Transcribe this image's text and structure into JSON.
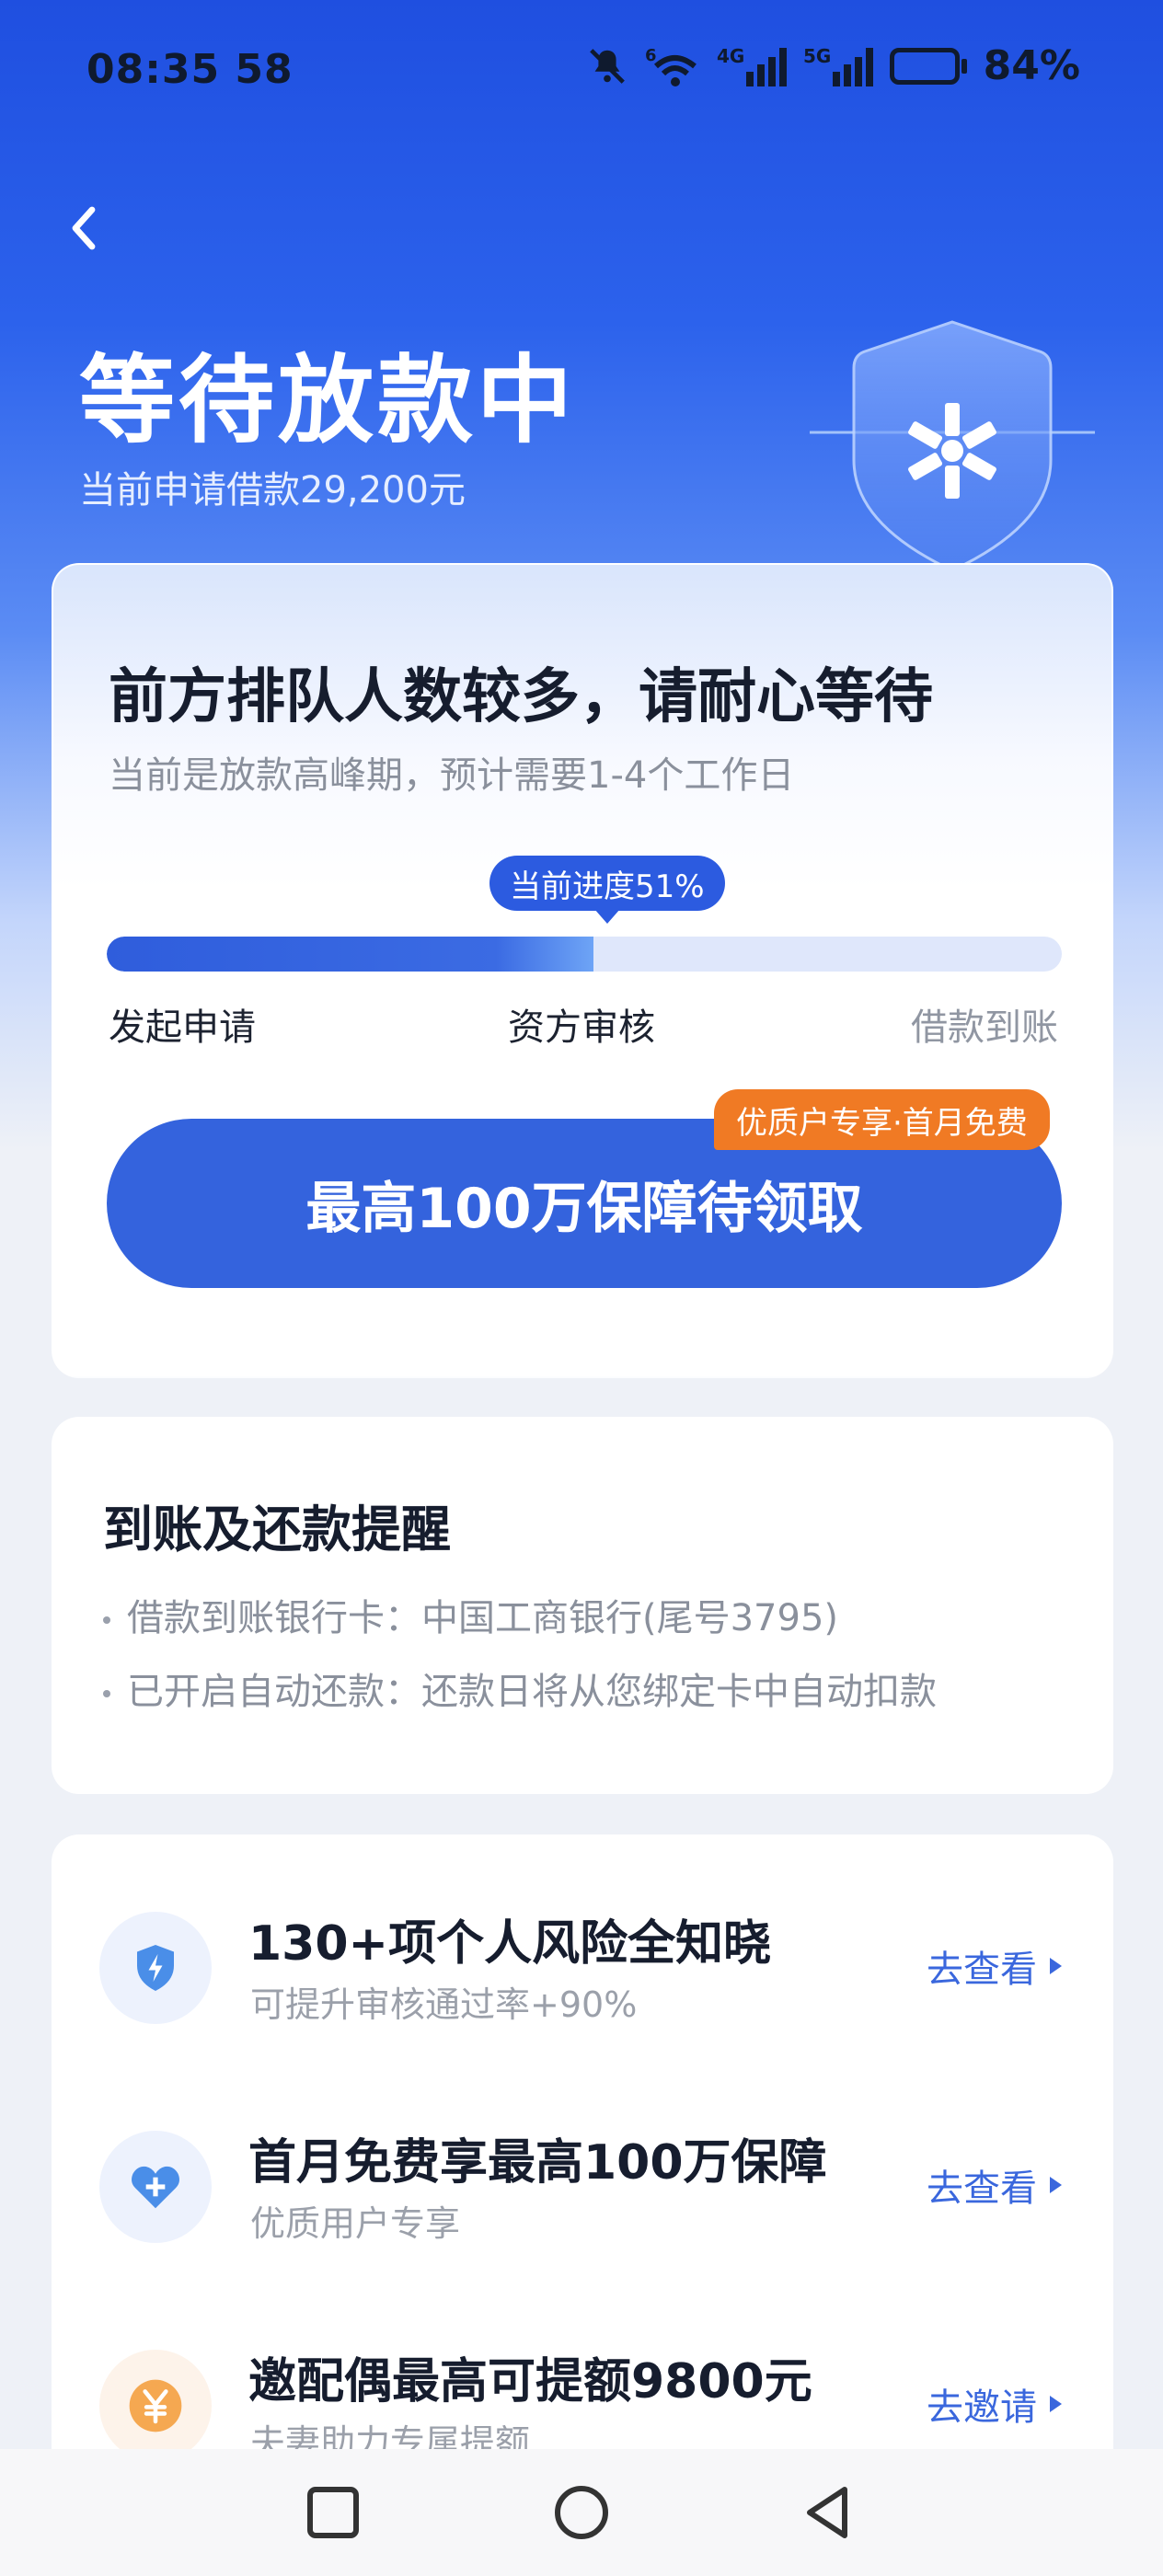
{
  "status_bar": {
    "time": "08:35 58",
    "network_labels": [
      "6",
      "4G",
      "5G"
    ],
    "battery_text": "84%",
    "battery_level": 0.84
  },
  "header": {
    "title": "等待放款中",
    "subtitle": "当前申请借款29,200元"
  },
  "progress_card": {
    "title": "前方排队人数较多，请耐心等待",
    "note": "当前是放款高峰期，预计需要1-4个工作日",
    "progress_label": "当前进度51%",
    "progress_percent": 51,
    "steps": [
      "发起申请",
      "资方审核",
      "借款到账"
    ],
    "cta_label": "最高100万保障待领取",
    "cta_badge": "优质户专享·首月免费"
  },
  "reminder": {
    "title": "到账及还款提醒",
    "lines": [
      "借款到账银行卡：中国工商银行(尾号3795)",
      "已开启自动还款：还款日将从您绑定卡中自动扣款"
    ]
  },
  "services": [
    {
      "icon": "shield-bolt-icon",
      "title": "130+项个人风险全知晓",
      "subtitle": "可提升审核通过率+90%",
      "action": "去查看"
    },
    {
      "icon": "heart-plus-icon",
      "title": "首月免费享最高100万保障",
      "subtitle": "优质用户专享",
      "action": "去查看"
    },
    {
      "icon": "yuan-coin-icon",
      "title": "邀配偶最高可提额9800元",
      "subtitle": "夫妻助力专属提额",
      "action": "去邀请"
    }
  ],
  "colors": {
    "brand_blue": "#3463dd",
    "badge_orange": "#f07a24",
    "link_blue": "#3a67dd"
  }
}
